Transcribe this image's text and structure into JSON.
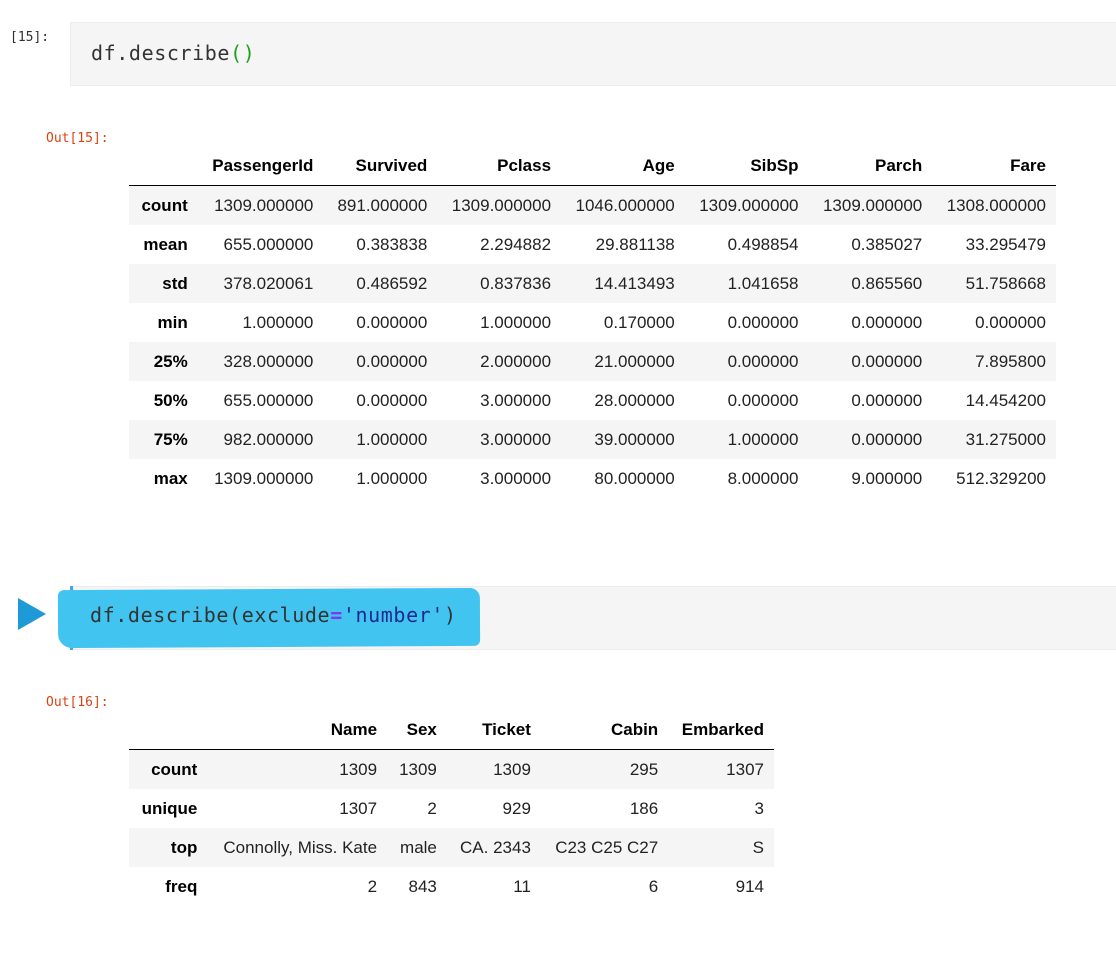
{
  "cell1": {
    "prompt": "[15]:",
    "code_func": "df.describe",
    "code_parens": "()",
    "out_prompt": "Out[15]:"
  },
  "table1": {
    "columns": [
      "PassengerId",
      "Survived",
      "Pclass",
      "Age",
      "SibSp",
      "Parch",
      "Fare"
    ],
    "rows": [
      {
        "label": "count",
        "values": [
          "1309.000000",
          "891.000000",
          "1309.000000",
          "1046.000000",
          "1309.000000",
          "1309.000000",
          "1308.000000"
        ]
      },
      {
        "label": "mean",
        "values": [
          "655.000000",
          "0.383838",
          "2.294882",
          "29.881138",
          "0.498854",
          "0.385027",
          "33.295479"
        ]
      },
      {
        "label": "std",
        "values": [
          "378.020061",
          "0.486592",
          "0.837836",
          "14.413493",
          "1.041658",
          "0.865560",
          "51.758668"
        ]
      },
      {
        "label": "min",
        "values": [
          "1.000000",
          "0.000000",
          "1.000000",
          "0.170000",
          "0.000000",
          "0.000000",
          "0.000000"
        ]
      },
      {
        "label": "25%",
        "values": [
          "328.000000",
          "0.000000",
          "2.000000",
          "21.000000",
          "0.000000",
          "0.000000",
          "7.895800"
        ]
      },
      {
        "label": "50%",
        "values": [
          "655.000000",
          "0.000000",
          "3.000000",
          "28.000000",
          "0.000000",
          "0.000000",
          "14.454200"
        ]
      },
      {
        "label": "75%",
        "values": [
          "982.000000",
          "1.000000",
          "3.000000",
          "39.000000",
          "1.000000",
          "0.000000",
          "31.275000"
        ]
      },
      {
        "label": "max",
        "values": [
          "1309.000000",
          "1.000000",
          "3.000000",
          "80.000000",
          "8.000000",
          "9.000000",
          "512.329200"
        ]
      }
    ]
  },
  "cell2": {
    "code_func": "df.describe(",
    "code_arg": "exclude",
    "code_eq": "=",
    "code_str": "'number'",
    "code_close": ")",
    "out_prompt": "Out[16]:"
  },
  "table2": {
    "columns": [
      "Name",
      "Sex",
      "Ticket",
      "Cabin",
      "Embarked"
    ],
    "rows": [
      {
        "label": "count",
        "values": [
          "1309",
          "1309",
          "1309",
          "295",
          "1307"
        ]
      },
      {
        "label": "unique",
        "values": [
          "1307",
          "2",
          "929",
          "186",
          "3"
        ]
      },
      {
        "label": "top",
        "values": [
          "Connolly, Miss. Kate",
          "male",
          "CA. 2343",
          "C23 C25 C27",
          "S"
        ]
      },
      {
        "label": "freq",
        "values": [
          "2",
          "843",
          "11",
          "6",
          "914"
        ]
      }
    ]
  },
  "colors": {
    "out_prompt": "#d84315",
    "highlight": "#41c4f0",
    "run_button": "#1e9bd7",
    "paren": "#1aa31a"
  },
  "icons": {
    "run": "play-triangle-icon"
  }
}
